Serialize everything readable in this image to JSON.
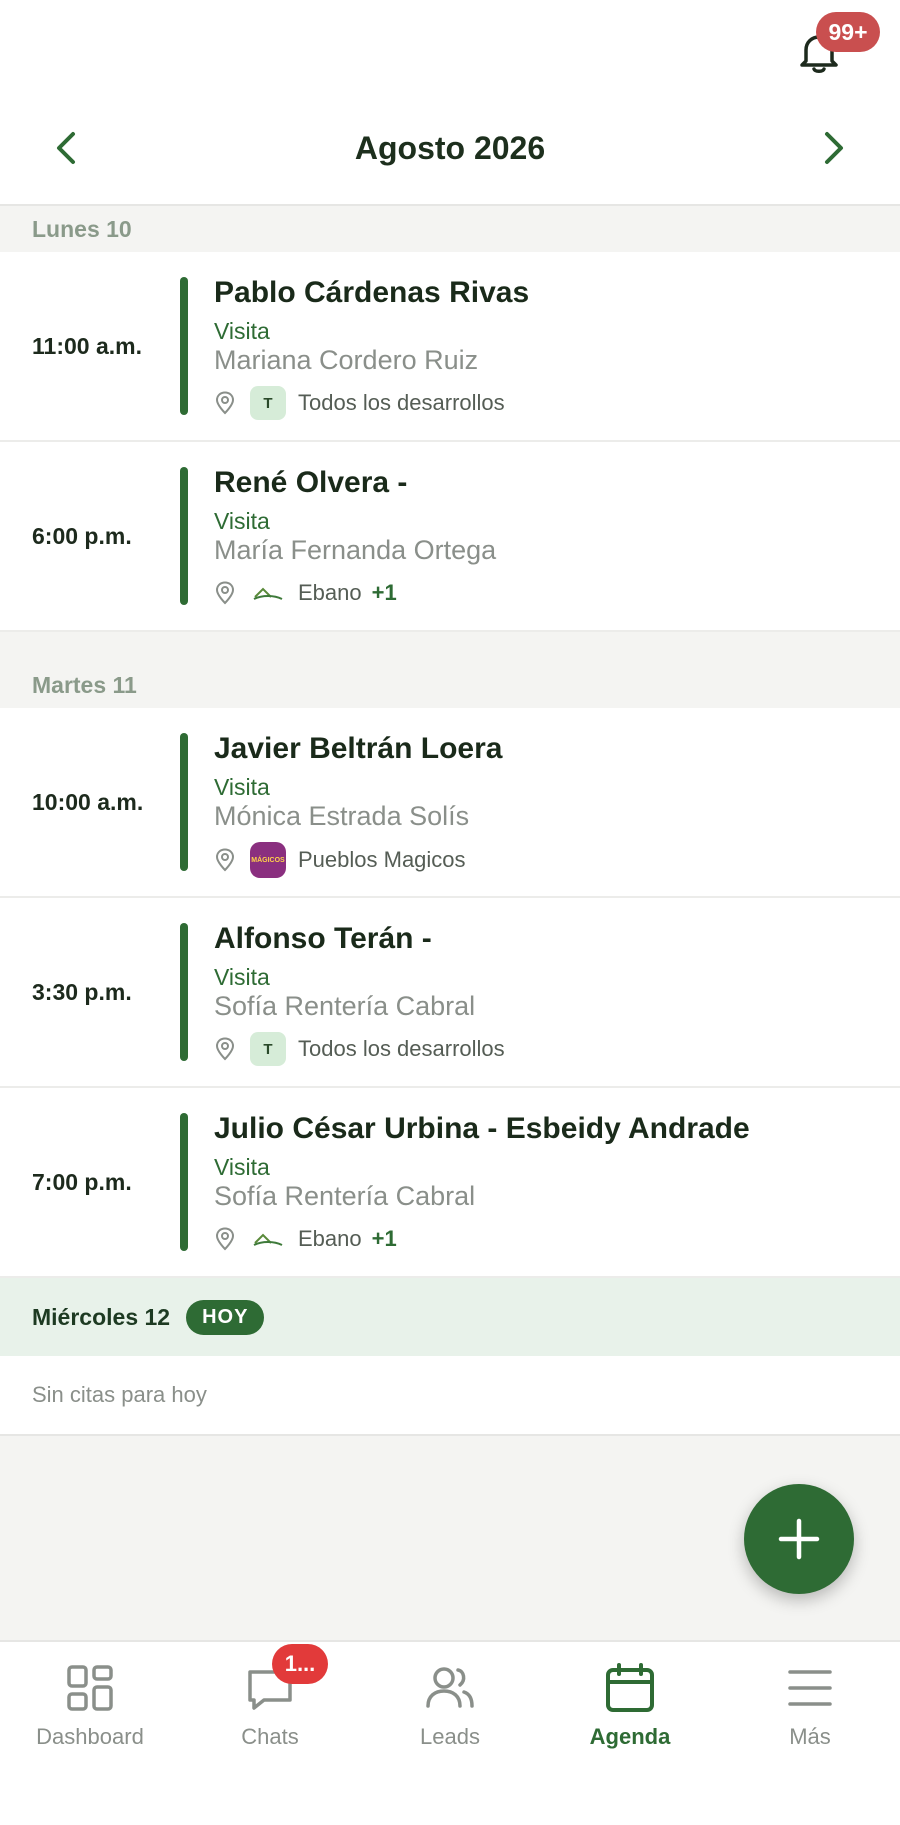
{
  "header": {
    "notification_badge": "99+",
    "month_title": "Agosto 2026"
  },
  "days": [
    {
      "label": "Lunes 10",
      "appointments": [
        {
          "time": "11:00 a.m.",
          "name": "Pablo Cárdenas Rivas",
          "type": "Visita",
          "agent": "Mariana Cordero Ruiz",
          "development": "Todos los desarrollos",
          "dev_icon": "T",
          "extra": ""
        },
        {
          "time": "6:00 p.m.",
          "name": "René Olvera -",
          "type": "Visita",
          "agent": "María Fernanda Ortega",
          "development": "Ebano",
          "dev_icon": "ebano-logo",
          "extra": "+1"
        }
      ]
    },
    {
      "label": "Martes 11",
      "appointments": [
        {
          "time": "10:00 a.m.",
          "name": "Javier Beltrán Loera",
          "type": "Visita",
          "agent": "Mónica Estrada Solís",
          "development": "Pueblos Magicos",
          "dev_icon": "pueblos-logo",
          "extra": ""
        },
        {
          "time": "3:30 p.m.",
          "name": "Alfonso Terán -",
          "type": "Visita",
          "agent": "Sofía Rentería Cabral",
          "development": "Todos los desarrollos",
          "dev_icon": "T",
          "extra": ""
        },
        {
          "time": "7:00 p.m.",
          "name": "Julio César Urbina - Esbeidy Andrade",
          "type": "Visita",
          "agent": "Sofía Rentería Cabral",
          "development": "Ebano",
          "dev_icon": "ebano-logo",
          "extra": "+1"
        }
      ]
    },
    {
      "label": "Miércoles 12",
      "today_badge": "HOY",
      "empty_text": "Sin citas para hoy"
    }
  ],
  "pueblos_logo_text": "MÁGICOS",
  "tabs": [
    {
      "label": "Dashboard",
      "icon": "grid-icon"
    },
    {
      "label": "Chats",
      "icon": "chat-icon",
      "badge": "1..."
    },
    {
      "label": "Leads",
      "icon": "users-icon"
    },
    {
      "label": "Agenda",
      "icon": "calendar-icon",
      "active": true
    },
    {
      "label": "Más",
      "icon": "menu-icon"
    }
  ],
  "colors": {
    "brand": "#2e6b34",
    "badge": "#c94f4f",
    "chat_badge": "#e23a3a"
  }
}
